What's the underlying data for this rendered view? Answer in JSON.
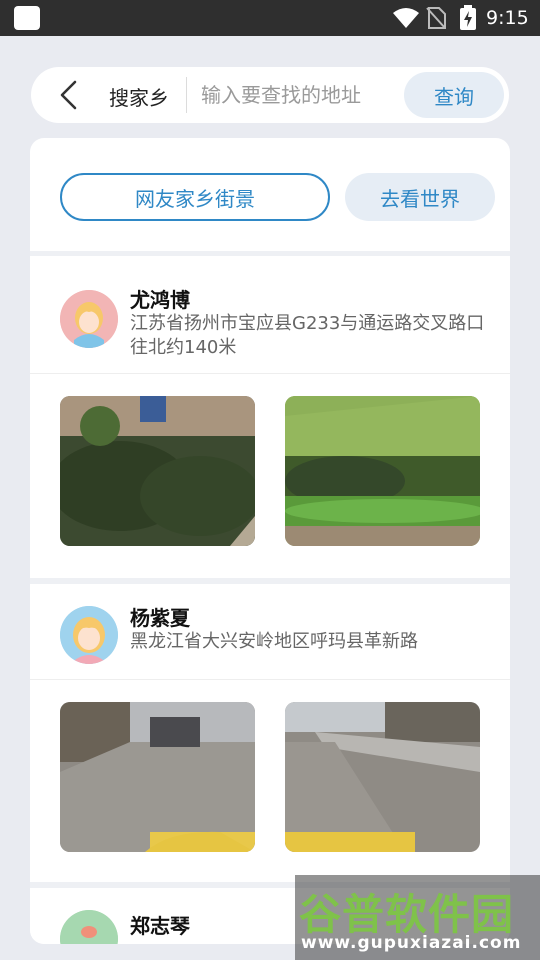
{
  "status_bar": {
    "time": "9:15"
  },
  "search_bar": {
    "site_name": "搜家乡",
    "placeholder": "输入要查找的地址",
    "query_label": "查询"
  },
  "tabs": {
    "active_label": "网友家乡街景",
    "inactive_label": "去看世界"
  },
  "feed": [
    {
      "name": "尤鸿博",
      "address": "江苏省扬州市宝应县G233与通运路交叉路口往北约140米"
    },
    {
      "name": "杨紫夏",
      "address": "黑龙江省大兴安岭地区呼玛县革新路"
    },
    {
      "name": "郑志琴"
    }
  ],
  "watermark": {
    "title": "谷普软件园",
    "url": "www.gupuxiazai.com"
  },
  "colors": {
    "accent": "#2f88c6",
    "tab_bg": "#e6edf5",
    "page_bg": "#e9ebf1"
  }
}
